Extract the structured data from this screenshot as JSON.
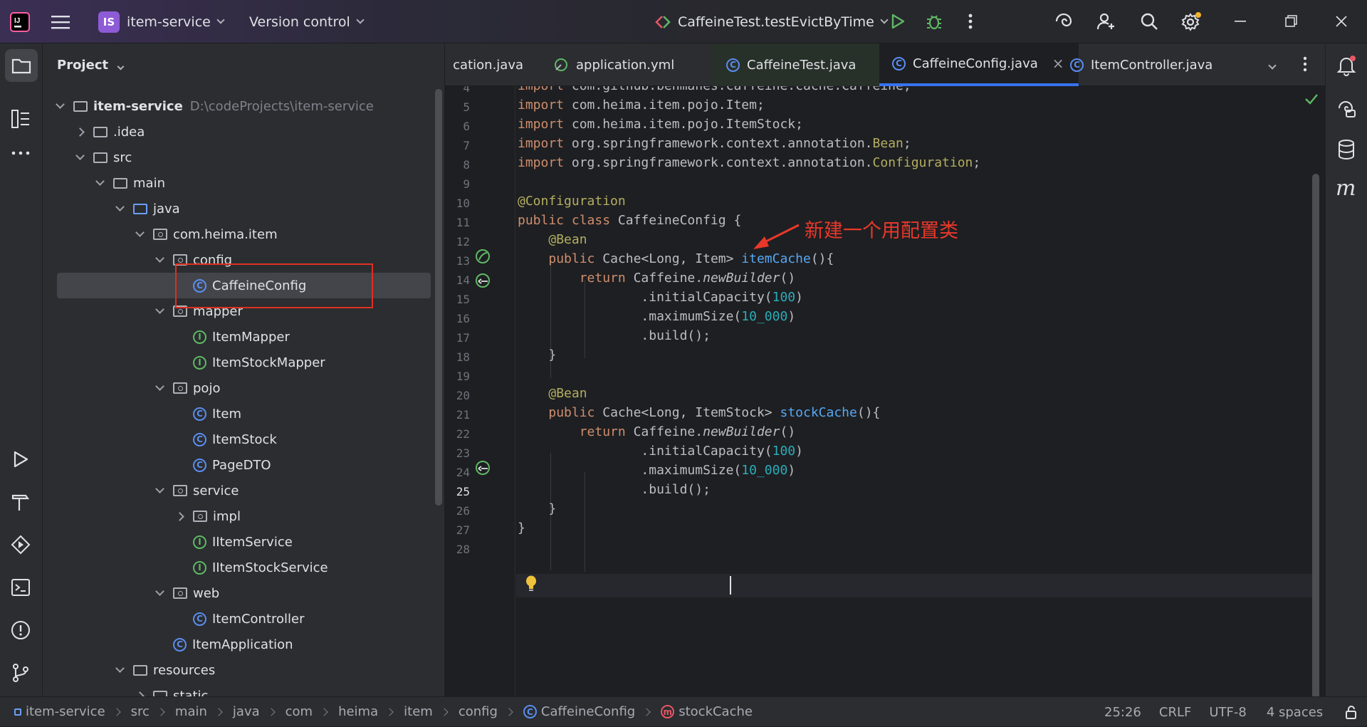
{
  "titlebar": {
    "project_badge": "IS",
    "project_name": "item-service",
    "vcs_label": "Version control",
    "run_config": "CaffeineTest.testEvictByTime"
  },
  "project_panel": {
    "title": "Project",
    "tree": [
      {
        "label": "item-service",
        "path": "D:\\codeProjects\\item-service",
        "icon": "module-folder-icon",
        "expanded": true,
        "depth": 0,
        "bold": true
      },
      {
        "label": ".idea",
        "icon": "folder-icon",
        "expanded": false,
        "depth": 1
      },
      {
        "label": "src",
        "icon": "folder-icon",
        "expanded": true,
        "depth": 1
      },
      {
        "label": "main",
        "icon": "folder-icon",
        "expanded": true,
        "depth": 2
      },
      {
        "label": "java",
        "icon": "source-folder-icon",
        "expanded": true,
        "depth": 3
      },
      {
        "label": "com.heima.item",
        "icon": "package-icon",
        "expanded": true,
        "depth": 4
      },
      {
        "label": "config",
        "icon": "package-icon",
        "expanded": true,
        "depth": 5
      },
      {
        "label": "CaffeineConfig",
        "icon": "class-icon",
        "depth": 6,
        "selected": true
      },
      {
        "label": "mapper",
        "icon": "package-icon",
        "expanded": true,
        "depth": 5
      },
      {
        "label": "ItemMapper",
        "icon": "interface-icon",
        "depth": 6
      },
      {
        "label": "ItemStockMapper",
        "icon": "interface-icon",
        "depth": 6
      },
      {
        "label": "pojo",
        "icon": "package-icon",
        "expanded": true,
        "depth": 5
      },
      {
        "label": "Item",
        "icon": "class-icon",
        "depth": 6
      },
      {
        "label": "ItemStock",
        "icon": "class-icon",
        "depth": 6
      },
      {
        "label": "PageDTO",
        "icon": "class-icon",
        "depth": 6
      },
      {
        "label": "service",
        "icon": "package-icon",
        "expanded": true,
        "depth": 5
      },
      {
        "label": "impl",
        "icon": "package-icon",
        "expanded": false,
        "depth": 6
      },
      {
        "label": "IItemService",
        "icon": "interface-icon",
        "depth": 6
      },
      {
        "label": "IItemStockService",
        "icon": "interface-icon",
        "depth": 6
      },
      {
        "label": "web",
        "icon": "package-icon",
        "expanded": true,
        "depth": 5
      },
      {
        "label": "ItemController",
        "icon": "class-icon",
        "depth": 6
      },
      {
        "label": "ItemApplication",
        "icon": "spring-class-icon",
        "depth": 5
      },
      {
        "label": "resources",
        "icon": "resources-folder-icon",
        "expanded": true,
        "depth": 3
      },
      {
        "label": "static",
        "icon": "folder-icon",
        "expanded": false,
        "depth": 4
      }
    ]
  },
  "tabs": [
    {
      "label": "cation.java",
      "icon": "none"
    },
    {
      "label": "application.yml",
      "icon": "yaml-icon"
    },
    {
      "label": "CaffeineTest.java",
      "icon": "test-class-icon"
    },
    {
      "label": "CaffeineConfig.java",
      "icon": "class-icon",
      "active": true,
      "close": "×"
    },
    {
      "label": "ItemController.java",
      "icon": "class-icon"
    }
  ],
  "editor": {
    "lines": [
      {
        "n": "4",
        "html": "<span class=\"kw\">import</span> com.github.benmanes.caffeine.cache.Caffeine;"
      },
      {
        "n": "5",
        "html": "<span class=\"kw\">import</span> com.heima.item.pojo.Item;"
      },
      {
        "n": "6",
        "html": "<span class=\"kw\">import</span> com.heima.item.pojo.ItemStock;"
      },
      {
        "n": "7",
        "html": "<span class=\"kw\">import</span> org.springframework.context.annotation.<span class=\"ann\">Bean</span>;"
      },
      {
        "n": "8",
        "html": "<span class=\"kw\">import</span> org.springframework.context.annotation.<span class=\"ann\">Configuration</span>;"
      },
      {
        "n": "9",
        "html": ""
      },
      {
        "n": "10",
        "html": "<span class=\"ann\">@Configuration</span>"
      },
      {
        "n": "11",
        "html": "<span class=\"kw\">public class</span> CaffeineConfig {"
      },
      {
        "n": "12",
        "html": "    <span class=\"ann\">@Bean</span>"
      },
      {
        "n": "13",
        "html": "    <span class=\"kw\">public</span> Cache&lt;Long, Item&gt; <span class=\"fn\">itemCache</span>(){"
      },
      {
        "n": "14",
        "html": "        <span class=\"kw\">return</span> Caffeine.<span class=\"it\">newBuilder</span>()"
      },
      {
        "n": "15",
        "html": "                .initialCapacity(<span class=\"num\">100</span>)"
      },
      {
        "n": "16",
        "html": "                .maximumSize(<span class=\"num\">10_000</span>)"
      },
      {
        "n": "17",
        "html": "                .build();"
      },
      {
        "n": "18",
        "html": "    }"
      },
      {
        "n": "19",
        "html": ""
      },
      {
        "n": "20",
        "html": "    <span class=\"ann\">@Bean</span>"
      },
      {
        "n": "21",
        "html": "    <span class=\"kw\">public</span> Cache&lt;Long, ItemStock&gt; <span class=\"fn\">stockCache</span>(){"
      },
      {
        "n": "22",
        "html": "        <span class=\"kw\">return</span> Caffeine.<span class=\"it\">newBuilder</span>()"
      },
      {
        "n": "23",
        "html": "                .initialCapacity(<span class=\"num\">100</span>)"
      },
      {
        "n": "24",
        "html": "                .maximumSize(<span class=\"num\">10_000</span>)"
      },
      {
        "n": "25",
        "html": "                .build();"
      },
      {
        "n": "26",
        "html": "    }"
      },
      {
        "n": "27",
        "html": "}"
      },
      {
        "n": "28",
        "html": ""
      }
    ],
    "current_line": "25"
  },
  "annotation": {
    "text": "新建一个用配置类"
  },
  "statusbar": {
    "breadcrumbs": [
      "item-service",
      "src",
      "main",
      "java",
      "com",
      "heima",
      "item",
      "config",
      "CaffeineConfig",
      "stockCache"
    ],
    "position": "25:26",
    "line_sep": "CRLF",
    "encoding": "UTF-8",
    "indent": "4 spaces"
  },
  "colors": {
    "accent": "#3574f0",
    "annotation_red": "#e02f21"
  }
}
